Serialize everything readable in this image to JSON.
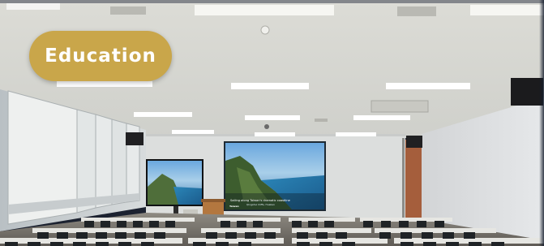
{
  "card": {
    "category_label": "Education",
    "badge_color": "#c9a64a",
    "image_subject": "lecture-hall-with-projection-screens"
  },
  "screens": {
    "main_screen_text": "Sailing along Taiwan's dramatic coastline",
    "main_screen_subtext": "Qingshui Cliffs, Hualien",
    "main_screen_logo": "Taiwan"
  }
}
